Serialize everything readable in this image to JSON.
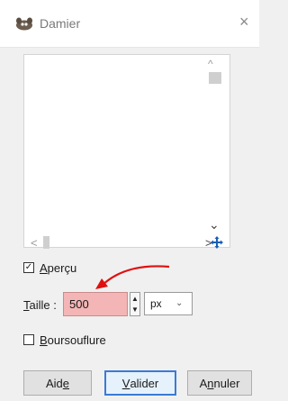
{
  "window": {
    "title": "Damier",
    "close_glyph": "×",
    "icon": "gimp-icon"
  },
  "preview": {
    "scroll_up": "^",
    "scroll_down": "⌄",
    "scroll_left": "<",
    "scroll_right": ">",
    "nav_icon": "navigate-icon"
  },
  "options": {
    "preview_toggle": {
      "label": "Aperçu",
      "underline": "A",
      "rest": "perçu",
      "checked": true
    },
    "size_label": "Taille :",
    "size_underline": "T",
    "size_rest": "aille :",
    "size_value": "500",
    "unit": "px",
    "unit_chevron": "⌄",
    "puff_toggle": {
      "label": "Boursouflure",
      "underline": "B",
      "rest": "oursouflure",
      "checked": false
    }
  },
  "buttons": {
    "help": {
      "label": "Aide",
      "pre": "Aid",
      "underline": "e"
    },
    "ok": {
      "label": "Valider",
      "underline": "V",
      "rest": "alider"
    },
    "cancel": {
      "label": "Annuler",
      "pre": "A",
      "underline": "n",
      "rest": "nuler"
    }
  },
  "colors": {
    "size_field_bg": "#f3b5b5",
    "annotation_arrow": "#e01010",
    "focus_border": "#3a7bd5"
  }
}
